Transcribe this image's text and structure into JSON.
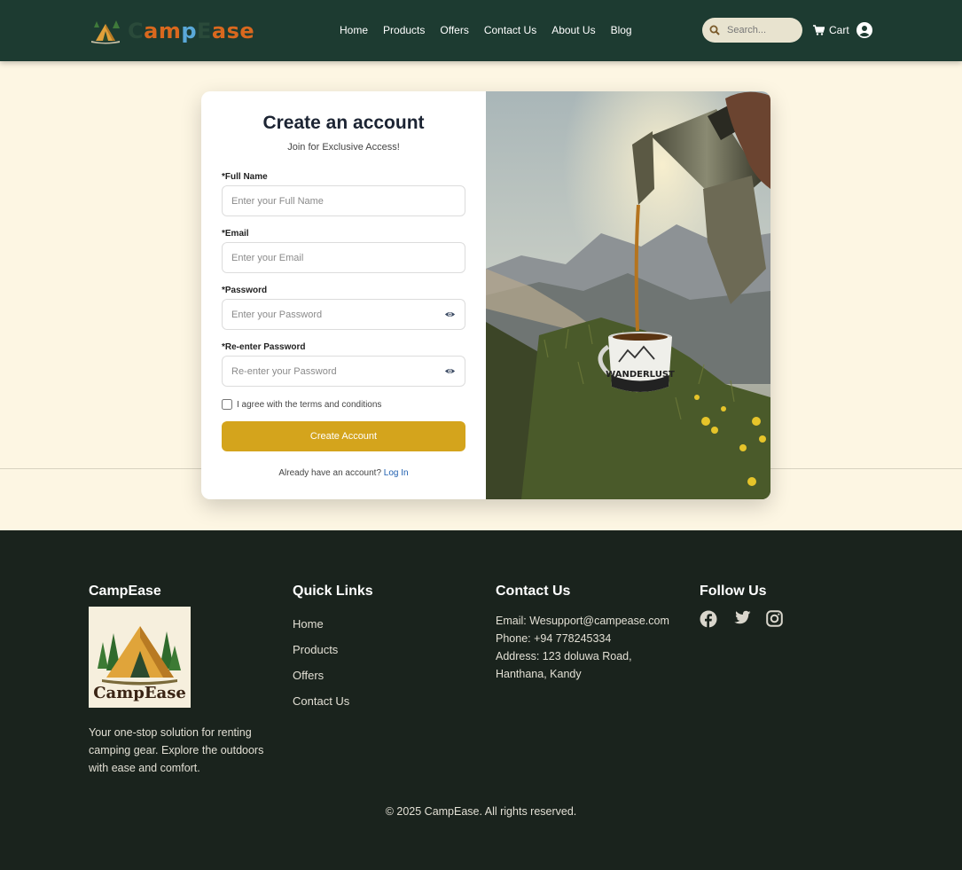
{
  "header": {
    "brand": {
      "part1": "C",
      "part2": "am",
      "part3": "p",
      "part4": "E",
      "part5": "ase"
    },
    "nav": [
      "Home",
      "Products",
      "Offers",
      "Contact Us",
      "About Us",
      "Blog"
    ],
    "search_placeholder": "Search...",
    "cart_label": "Cart"
  },
  "form": {
    "title": "Create an account",
    "subtitle": "Join for Exclusive Access!",
    "full_name_label": "*Full Name",
    "full_name_placeholder": "Enter your Full Name",
    "email_label": "*Email",
    "email_placeholder": "Enter your Email",
    "password_label": "*Password",
    "password_placeholder": "Enter your Password",
    "reenter_label": "*Re-enter Password",
    "reenter_placeholder": "Re-enter your Password",
    "terms_label": "I agree with the terms and conditions",
    "submit_label": "Create Account",
    "login_prompt": "Already have an account?",
    "login_link": "Log In"
  },
  "photo": {
    "mug_text": "WANDERLUST"
  },
  "footer": {
    "brand_title": "CampEase",
    "logo_text": "CampEase",
    "description": "Your one-stop solution for renting camping gear. Explore the outdoors with ease and comfort.",
    "quick_links_title": "Quick Links",
    "quick_links": [
      "Home",
      "Products",
      "Offers",
      "Contact Us"
    ],
    "contact_title": "Contact Us",
    "email": "Email: Wesupport@campease.com",
    "phone": "Phone: +94 778245334",
    "address": "Address: 123 doluwa Road, Hanthana, Kandy",
    "follow_title": "Follow Us",
    "socials": [
      "facebook-icon",
      "twitter-icon",
      "instagram-icon"
    ],
    "copyright": "© 2025 CampEase. All rights reserved."
  },
  "colors": {
    "header_bg": "#1d3b31",
    "page_bg": "#fdf6e3",
    "accent": "#d4a41c",
    "footer_bg": "#1a231d",
    "link": "#1f5fb0"
  }
}
